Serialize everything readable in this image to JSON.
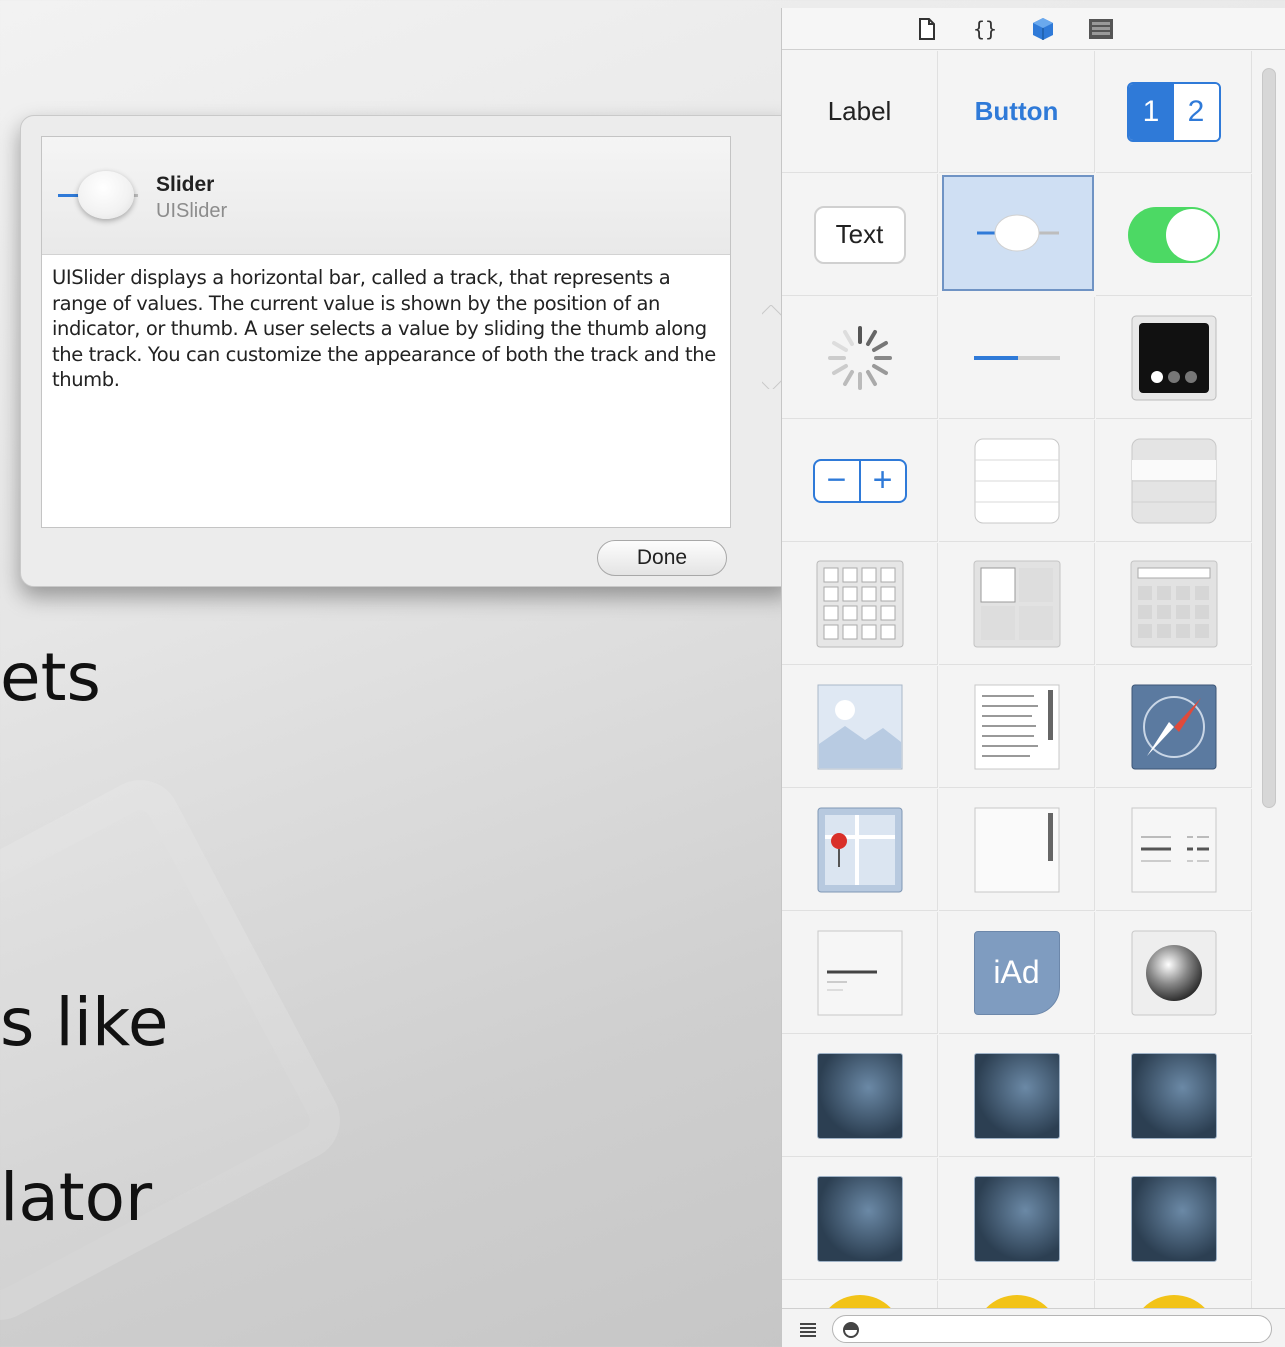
{
  "slide": {
    "lines": [
      "ets",
      "s like",
      "lator"
    ]
  },
  "popover": {
    "title": "Slider",
    "subtitle": "UISlider",
    "description": "UISlider displays a horizontal bar, called a track, that represents a range of values. The current value is shown by the position of an indicator, or thumb. A user selects a value by sliding the thumb along the track. You can customize the appearance of both the track and the thumb.",
    "done_label": "Done"
  },
  "library": {
    "tabs": [
      "file-icon",
      "braces-icon",
      "object-cube-icon",
      "media-icon"
    ],
    "selected_tab": "object-cube-icon",
    "label_text": "Label",
    "button_text": "Button",
    "segment_1": "1",
    "segment_2": "2",
    "textfield_text": "Text",
    "stepper_minus": "−",
    "stepper_plus": "+",
    "iad_text": "iAd",
    "selected_item": "Slider",
    "filter_placeholder": ""
  }
}
